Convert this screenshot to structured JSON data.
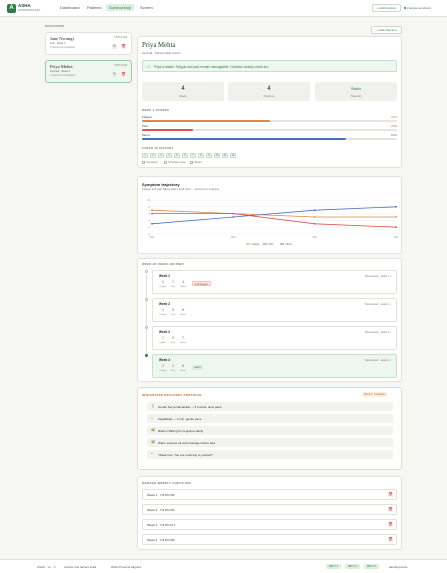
{
  "app": {
    "logo_letter": "A",
    "name": "ASHA",
    "subtitle": "AFTERSHOCK INCL"
  },
  "nav": {
    "items": [
      "Dashboard",
      "Patients",
      "Survivorship",
      "Screen"
    ],
    "active": "Survivorship"
  },
  "header": {
    "add_label": "+ Add survivor",
    "active_count": "2 active survivors"
  },
  "sidebar": {
    "section_label": "SURVIVORS",
    "survivors": [
      {
        "name": "Jane Nwangi",
        "date": "7-8 P.D.M4",
        "meta": "Lost · Week 1",
        "sub": "0 check-ins completed"
      },
      {
        "name": "Priya Mehta",
        "date": "7-8 P.D.M4",
        "meta": "Cervical · Week 4",
        "sub": "4 check-ins completed"
      }
    ]
  },
  "main": {
    "new_checkin_label": "+ Add check-in",
    "title": "Priya Mehta",
    "subtitle": "cervical · Survivorship cohort",
    "banner": "Priya is stable. Fatigue and pain remain manageable. Continue weekly check-ins.",
    "stats": [
      {
        "value": "4",
        "label": "Weeks"
      },
      {
        "value": "4",
        "label": "Check-ins"
      },
      {
        "value": "Stable",
        "label": "Trajectory"
      }
    ],
    "scores_label": "WEEK 4 SCORES",
    "scores": [
      {
        "name": "Fatigue",
        "value": "5/10",
        "fraction": 0.5,
        "color": "#e0884a"
      },
      {
        "name": "Pain",
        "value": "2/10",
        "fraction": 0.2,
        "color": "#d9534f"
      },
      {
        "name": "Mood",
        "value": "8/10",
        "fraction": 0.8,
        "color": "#4a6fc0"
      }
    ],
    "history_label": "CHECK-IN HISTORY",
    "history_chips": [
      "1",
      "2",
      "3",
      "4",
      "5",
      "6",
      "7",
      "8",
      "9",
      "10",
      "11",
      "12"
    ],
    "history_legend": [
      "Completed",
      "Scheduled week",
      "Missed"
    ]
  },
  "chart": {
    "title": "Symptom trajectory",
    "subtitle": "Fatigue and pain falling while mood rises — recovery in progress",
    "legend": [
      "Fatigue",
      "Pain",
      "Mood"
    ]
  },
  "chart_data": {
    "type": "line",
    "categories": [
      "Wk1",
      "Wk2",
      "Wk3",
      "Wk4"
    ],
    "ylim": [
      0,
      10
    ],
    "yticks": [
      "10",
      "8",
      "6",
      "4",
      "2",
      "0"
    ],
    "series": [
      {
        "name": "Fatigue",
        "color": "#e0884a",
        "values": [
          7,
          6,
          5,
          5
        ]
      },
      {
        "name": "Pain",
        "color": "#d9534f",
        "values": [
          6,
          6,
          3,
          2
        ]
      },
      {
        "name": "Mood",
        "color": "#4a6fc0",
        "values": [
          3,
          5,
          7,
          8
        ]
      }
    ]
  },
  "journey": {
    "label": "WEEK-BY-WEEK JOURNEY",
    "weeks": [
      {
        "name": "Week 1",
        "status": "Recovered · week 1 ✓",
        "fatigue": "5",
        "pain": "7",
        "mood": "4",
        "badge": "Self-flagged",
        "badge_type": "red"
      },
      {
        "name": "Week 2",
        "status": "Recovered · week 2 ✓",
        "fatigue": "5",
        "pain": "5",
        "mood": "6",
        "badge": "",
        "badge_type": ""
      },
      {
        "name": "Week 3",
        "status": "Recovered · week 3 ✓",
        "fatigue": "2",
        "pain": "3",
        "mood": "7",
        "badge": "",
        "badge_type": ""
      },
      {
        "name": "Week 4",
        "status": "Recovered · week 4 ✓",
        "fatigue": "5",
        "pain": "2",
        "mood": "8",
        "badge": "Latest",
        "badge_type": "green"
      }
    ],
    "score_labels": [
      "Fatigue",
      "Pain",
      "Mood"
    ]
  },
  "protocol": {
    "label": "INTEGRATED RECOVERY PROTOCOL",
    "tag": "Week 4 · 5 activities",
    "items": [
      {
        "icon": "🚶",
        "text": "Gentle Surya Namaskar — 5 rounds, slow pace"
      },
      {
        "icon": "≈",
        "text": "Kapalbhati — 2 min, gentle pace"
      },
      {
        "icon": "🌿",
        "text": "Brahmi 300mg for cognitive clarity"
      },
      {
        "icon": "🌿",
        "text": "Warm sesame oil self-massage before bed"
      },
      {
        "icon": "❝",
        "text": "\"Week four. You are returning to yourself.\""
      }
    ]
  },
  "manage": {
    "label": "MANAGE WEEKLY CHECK-INS",
    "rows": [
      "Week 1 · 7-8 P.D M4",
      "Week 2 · 7-8 P.D M4",
      "Week 3 · 7-8 P.D M 7",
      "Week 4 · 7-8 P.D M4"
    ]
  },
  "footer": {
    "left": "ASHA · v1 · ©",
    "mid1": "Cancer risk factors india",
    "mid2": "WHO Protocol Aligned",
    "badges": [
      "RBI 7.1",
      "RBI 7.4",
      "RBI 7.5"
    ],
    "right": "aashaycancer"
  }
}
